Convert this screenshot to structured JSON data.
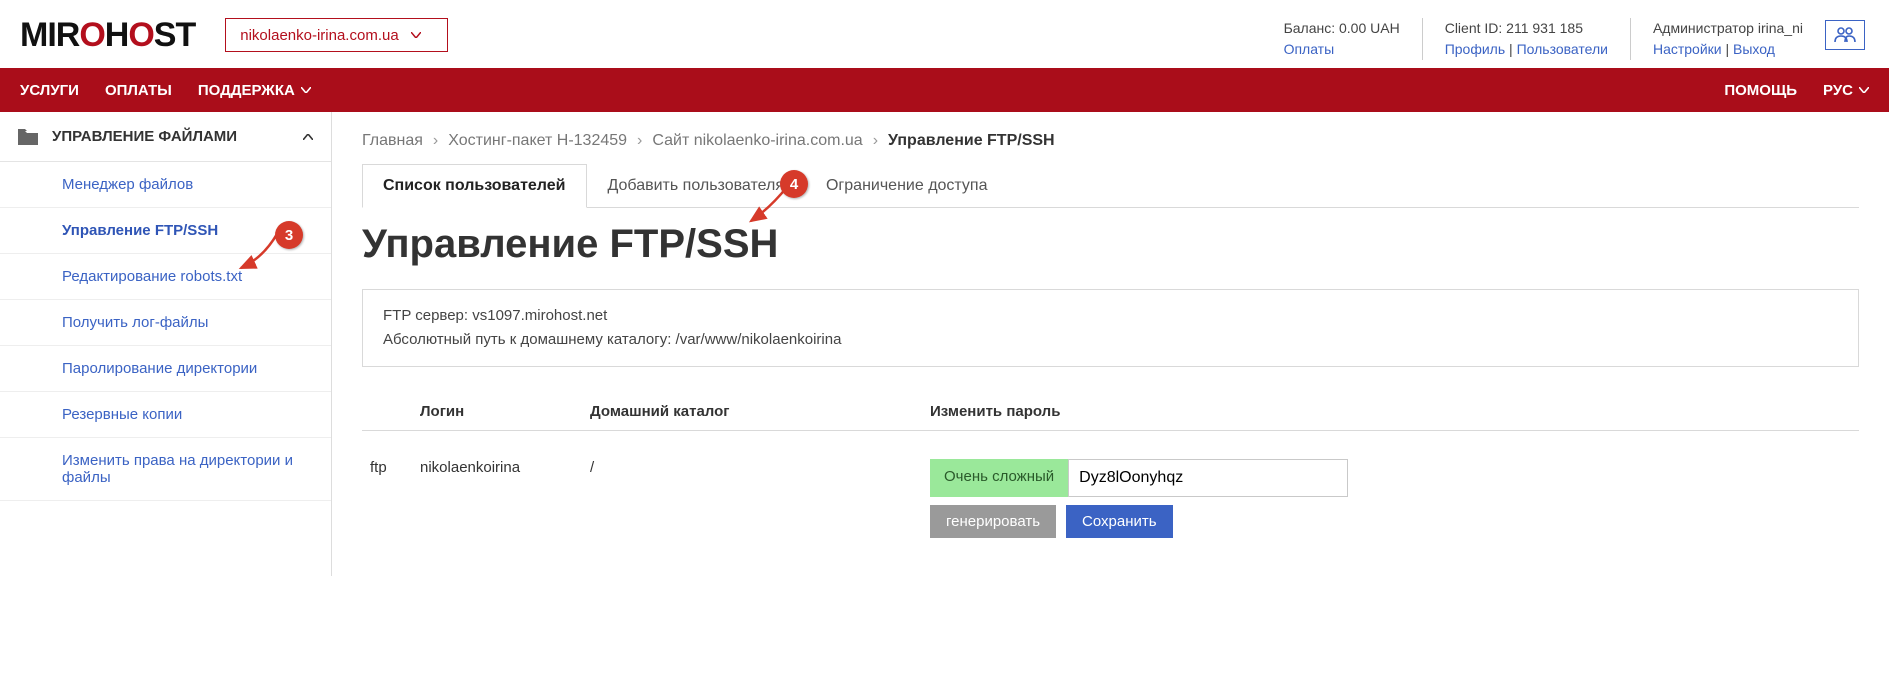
{
  "header": {
    "logo_parts": [
      "MIR",
      "O",
      "H",
      "O",
      "ST"
    ],
    "domain_selected": "nikolaenko-irina.com.ua",
    "balance_label": "Баланс: 0.00 UAH",
    "payments_link": "Оплаты",
    "client_id_label": "Client ID: 211 931 185",
    "profile_link": "Профиль",
    "users_link": "Пользователи",
    "admin_label": "Администратор irina_ni",
    "settings_link": "Настройки",
    "logout_link": "Выход"
  },
  "nav": {
    "services": "УСЛУГИ",
    "payments": "ОПЛАТЫ",
    "support": "ПОДДЕРЖКА",
    "help": "ПОМОЩЬ",
    "lang": "РУС"
  },
  "sidebar": {
    "header": "УПРАВЛЕНИЕ ФАЙЛАМИ",
    "items": [
      {
        "label": "Менеджер файлов"
      },
      {
        "label": "Управление FTP/SSH"
      },
      {
        "label": "Редактирование robots.txt"
      },
      {
        "label": "Получить лог-файлы"
      },
      {
        "label": "Паролирование директории"
      },
      {
        "label": "Резервные копии"
      },
      {
        "label": "Изменить права на директории и файлы"
      }
    ],
    "active_index": 1
  },
  "breadcrumb": {
    "items": [
      "Главная",
      "Хостинг-пакет H-132459",
      "Сайт nikolaenko-irina.com.ua"
    ],
    "current": "Управление FTP/SSH"
  },
  "tabs": {
    "items": [
      "Список пользователей",
      "Добавить пользователя",
      "Ограничение доступа"
    ],
    "active_index": 0
  },
  "page_title": "Управление FTP/SSH",
  "infobox": {
    "line1_label": "FTP сервер: ",
    "line1_value": "vs1097.mirohost.net",
    "line2_label": "Абсолютный путь к домашнему каталогу: ",
    "line2_value": "/var/www/nikolaenkoirina"
  },
  "table": {
    "col_type": "",
    "col_login": "Логин",
    "col_home": "Домашний каталог",
    "col_pw": "Изменить пароль",
    "rows": [
      {
        "proto": "ftp",
        "login": "nikolaenkoirina",
        "home": "/",
        "strength": "Очень сложный",
        "password": "Dyz8lOonyhqz",
        "btn_gen": "генерировать",
        "btn_save": "Сохранить"
      }
    ]
  },
  "markers": {
    "m3": "3",
    "m4": "4"
  }
}
